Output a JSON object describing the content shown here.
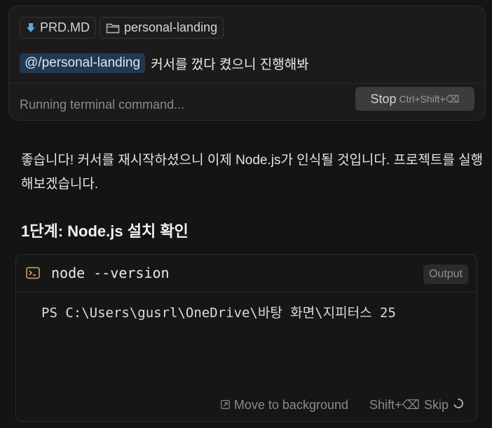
{
  "composer": {
    "chips": [
      {
        "icon": "download-arrow-icon",
        "label": "PRD.MD"
      },
      {
        "icon": "folder-icon",
        "label": "personal-landing"
      }
    ],
    "mention": "@/personal-landing",
    "message": "커서를 껐다 켰으니 진행해봐",
    "status": "Running terminal command...",
    "stop_label": "Stop",
    "stop_keys": "Ctrl+Shift+⌫"
  },
  "response": {
    "paragraph": "좋습니다! 커서를 재시작하셨으니 이제 Node.js가 인식될 것입니다. 프로젝트를 실행해보겠습니다.",
    "step_title": "1단계: Node.js 설치 확인"
  },
  "terminal": {
    "command": "node --version",
    "output_badge": "Output",
    "output_line": "PS C:\\Users\\gusrl\\OneDrive\\바탕 화면\\지피터스 25",
    "move_label": "Move to background",
    "skip_keys": "Shift+⌫",
    "skip_label": "Skip"
  },
  "colors": {
    "background": "#141414",
    "panel": "#1b1b1b",
    "mention_bg": "#213a52",
    "accent_icon": "#5ba7d8",
    "terminal_icon": "#e0a860"
  }
}
